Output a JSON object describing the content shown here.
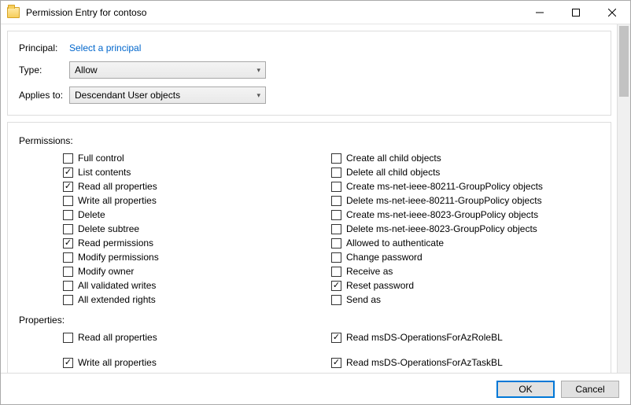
{
  "window": {
    "title": "Permission Entry for contoso"
  },
  "header": {
    "principal_label": "Principal:",
    "principal_link": "Select a principal",
    "type_label": "Type:",
    "type_value": "Allow",
    "applies_label": "Applies to:",
    "applies_value": "Descendant User objects"
  },
  "permissions": {
    "label": "Permissions:",
    "left": [
      {
        "label": "Full control",
        "checked": false
      },
      {
        "label": "List contents",
        "checked": true
      },
      {
        "label": "Read all properties",
        "checked": true
      },
      {
        "label": "Write all properties",
        "checked": false
      },
      {
        "label": "Delete",
        "checked": false
      },
      {
        "label": "Delete subtree",
        "checked": false
      },
      {
        "label": "Read permissions",
        "checked": true
      },
      {
        "label": "Modify permissions",
        "checked": false
      },
      {
        "label": "Modify owner",
        "checked": false
      },
      {
        "label": "All validated writes",
        "checked": false
      },
      {
        "label": "All extended rights",
        "checked": false
      }
    ],
    "right": [
      {
        "label": "Create all child objects",
        "checked": false
      },
      {
        "label": "Delete all child objects",
        "checked": false
      },
      {
        "label": "Create ms-net-ieee-80211-GroupPolicy objects",
        "checked": false
      },
      {
        "label": "Delete ms-net-ieee-80211-GroupPolicy objects",
        "checked": false
      },
      {
        "label": "Create ms-net-ieee-8023-GroupPolicy objects",
        "checked": false
      },
      {
        "label": "Delete ms-net-ieee-8023-GroupPolicy objects",
        "checked": false
      },
      {
        "label": "Allowed to authenticate",
        "checked": false
      },
      {
        "label": "Change password",
        "checked": false
      },
      {
        "label": "Receive as",
        "checked": false
      },
      {
        "label": "Reset password",
        "checked": true
      },
      {
        "label": "Send as",
        "checked": false
      }
    ]
  },
  "properties": {
    "label": "Properties:",
    "left": [
      {
        "label": "Read all properties",
        "checked": false
      },
      {
        "label": "Write all properties",
        "checked": true
      }
    ],
    "right": [
      {
        "label": "Read msDS-OperationsForAzRoleBL",
        "checked": true
      },
      {
        "label": "Read msDS-OperationsForAzTaskBL",
        "checked": true
      }
    ]
  },
  "footer": {
    "ok": "OK",
    "cancel": "Cancel"
  }
}
